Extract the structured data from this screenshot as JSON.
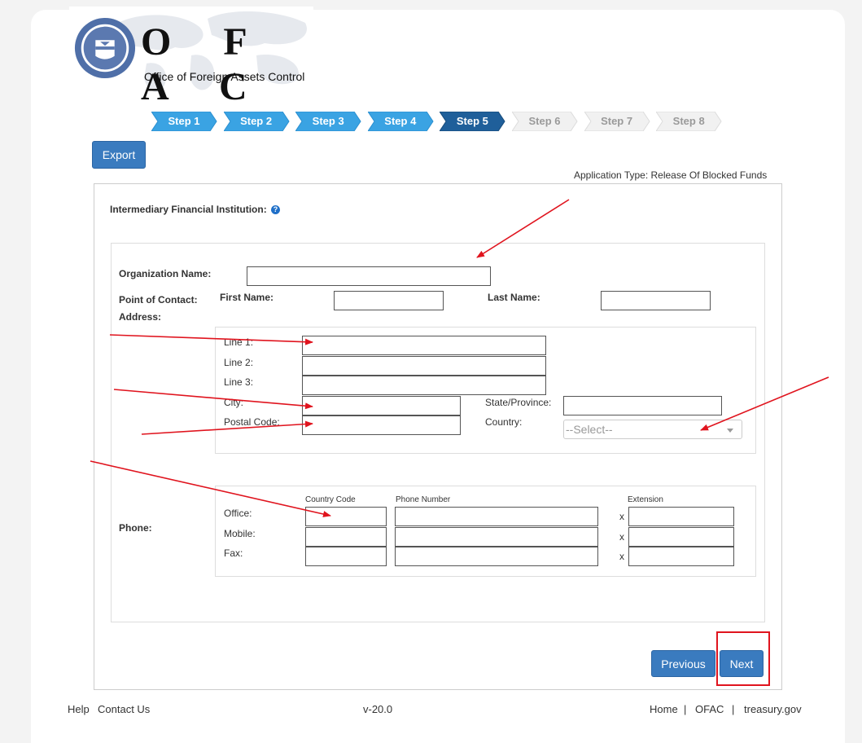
{
  "header": {
    "logo_letters": "O F A C",
    "logo_subtitle": "Office of Foreign Assets Control",
    "seal_year": "1789"
  },
  "steps": [
    {
      "label": "Step 1",
      "state": "done"
    },
    {
      "label": "Step 2",
      "state": "done"
    },
    {
      "label": "Step 3",
      "state": "done"
    },
    {
      "label": "Step 4",
      "state": "done"
    },
    {
      "label": "Step 5",
      "state": "current"
    },
    {
      "label": "Step 6",
      "state": "pending"
    },
    {
      "label": "Step 7",
      "state": "pending"
    },
    {
      "label": "Step 8",
      "state": "pending"
    }
  ],
  "toolbar": {
    "export_label": "Export"
  },
  "application_type": "Application Type: Release Of Blocked Funds",
  "section": {
    "title": "Intermediary Financial Institution:",
    "help_icon": "question-circle-icon"
  },
  "form": {
    "org_name_label": "Organization Name:",
    "poc_label": "Point of Contact:",
    "first_name_label": "First Name:",
    "last_name_label": "Last Name:",
    "address_label": "Address:",
    "line1_label": "Line 1:",
    "line2_label": "Line 2:",
    "line3_label": "Line 3:",
    "city_label": "City:",
    "state_label": "State/Province:",
    "postal_label": "Postal Code:",
    "country_label": "Country:",
    "country_value": "--Select--",
    "phone_label": "Phone:",
    "country_code_header": "Country Code",
    "phone_number_header": "Phone Number",
    "extension_header": "Extension",
    "office_label": "Office:",
    "mobile_label": "Mobile:",
    "fax_label": "Fax:",
    "x_label": "x"
  },
  "nav": {
    "previous_label": "Previous",
    "next_label": "Next"
  },
  "footer": {
    "help": "Help",
    "contact": "Contact Us",
    "version": "v-20.0",
    "home": "Home",
    "ofac": "OFAC",
    "treasury": "treasury.gov",
    "sep": "|"
  },
  "colors": {
    "step_done": "#3aa3e3",
    "step_current": "#1f5f9a",
    "button_blue": "#3a7bbf",
    "annotation_red": "#e0141e"
  }
}
